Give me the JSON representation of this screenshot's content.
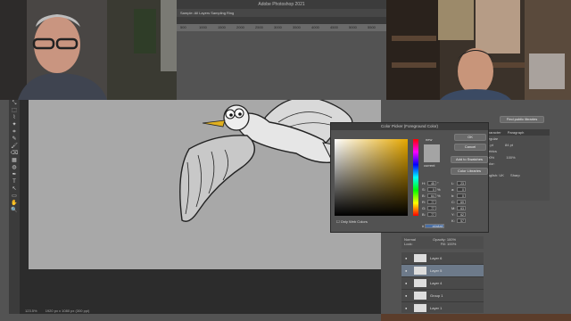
{
  "window": {
    "title": "Adobe Photoshop 2021",
    "options_text": "Sample: All Layers   Sampling Ring",
    "ruler_ticks": [
      "500",
      "1000",
      "1500",
      "2000",
      "2500",
      "3000",
      "3500",
      "4000",
      "4500",
      "5000",
      "5500"
    ],
    "status_zoom": "123.5%",
    "status_doc": "1920 px x 1080 px (300 ppi)"
  },
  "tools": [
    "⤡",
    "⬚",
    "⌇",
    "✦",
    "⌗",
    "✎",
    "🖌",
    "⌫",
    "▦",
    "◍",
    "✒",
    "T",
    "↖",
    "▭",
    "✋",
    "🔍"
  ],
  "picker": {
    "title": "Color Picker (Foreground Color)",
    "new_label": "new",
    "current_label": "current",
    "buttons": {
      "ok": "OK",
      "cancel": "Cancel",
      "add_swatches": "Add to Swatches",
      "color_libraries": "Color Libraries"
    },
    "only_web": "Only Web Colors",
    "hex_label": "#",
    "hex_value": "a4a4a4",
    "fields": [
      {
        "l": "H:",
        "v": "45",
        "u": "°",
        "l2": "L:",
        "v2": "23"
      },
      {
        "l": "S:",
        "v": "0",
        "u": "%",
        "l2": "a:",
        "v2": "0"
      },
      {
        "l": "B:",
        "v": "64",
        "u": "%",
        "l2": "b:",
        "v2": "0"
      },
      {
        "l": "R:",
        "v": "77",
        "u": "",
        "l2": "C:",
        "v2": "69"
      },
      {
        "l": "G:",
        "v": "77",
        "u": "",
        "l2": "M:",
        "v2": "63"
      },
      {
        "l": "B:",
        "v": "77",
        "u": "",
        "l2": "Y:",
        "v2": "62"
      },
      {
        "l": "",
        "v": "",
        "u": "",
        "l2": "K:",
        "v2": "57"
      }
    ],
    "colors": {
      "new": "#a4a4a4",
      "current": "#a4a4a4"
    }
  },
  "character": {
    "tabs": [
      "Character",
      "Paragraph"
    ],
    "font": "",
    "style": "Regular",
    "size": "14 pt",
    "leading": "84 pt",
    "tracking": "Metrics",
    "scale_v": "100%",
    "scale_h": "100%",
    "color_label": "Color:",
    "lang": "English: UK",
    "aa": "Sharp",
    "lookup_btn": "Find public libraries"
  },
  "layers": {
    "mode": "Normal",
    "opacity_label": "Opacity:",
    "opacity": "100%",
    "lock_label": "Lock:",
    "fill_label": "Fill:",
    "fill": "100%",
    "rows": [
      {
        "name": "Layer 6",
        "selected": false
      },
      {
        "name": "Layer 5",
        "selected": true
      },
      {
        "name": "Layer 4",
        "selected": false
      },
      {
        "name": "Group 1",
        "selected": false
      },
      {
        "name": "Layer 1",
        "selected": false
      }
    ]
  }
}
